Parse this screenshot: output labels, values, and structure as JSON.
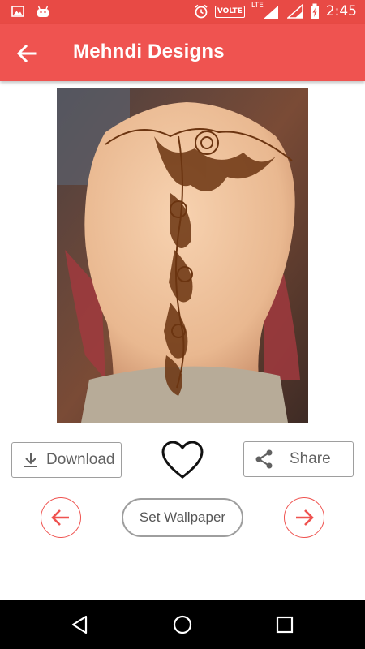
{
  "status_bar": {
    "left_icons": [
      "image-icon",
      "android-icon"
    ],
    "volte": "VOLTE",
    "network": "LTE",
    "time": "2:45"
  },
  "app_bar": {
    "title": "Mehndi Designs",
    "back_icon": "arrow-left-icon"
  },
  "actions": {
    "download_label": "Download",
    "share_label": "Share",
    "set_wallpaper_label": "Set Wallpaper",
    "favorite_icon": "heart-outline-icon",
    "prev_icon": "arrow-left-circle-icon",
    "next_icon": "arrow-right-circle-icon"
  },
  "colors": {
    "primary": "#ef5350",
    "status_bar": "#e84a45",
    "button_border": "#9e9e9e",
    "button_text": "#616161"
  },
  "system_nav": [
    "back-triangle-icon",
    "home-circle-icon",
    "recents-square-icon"
  ]
}
